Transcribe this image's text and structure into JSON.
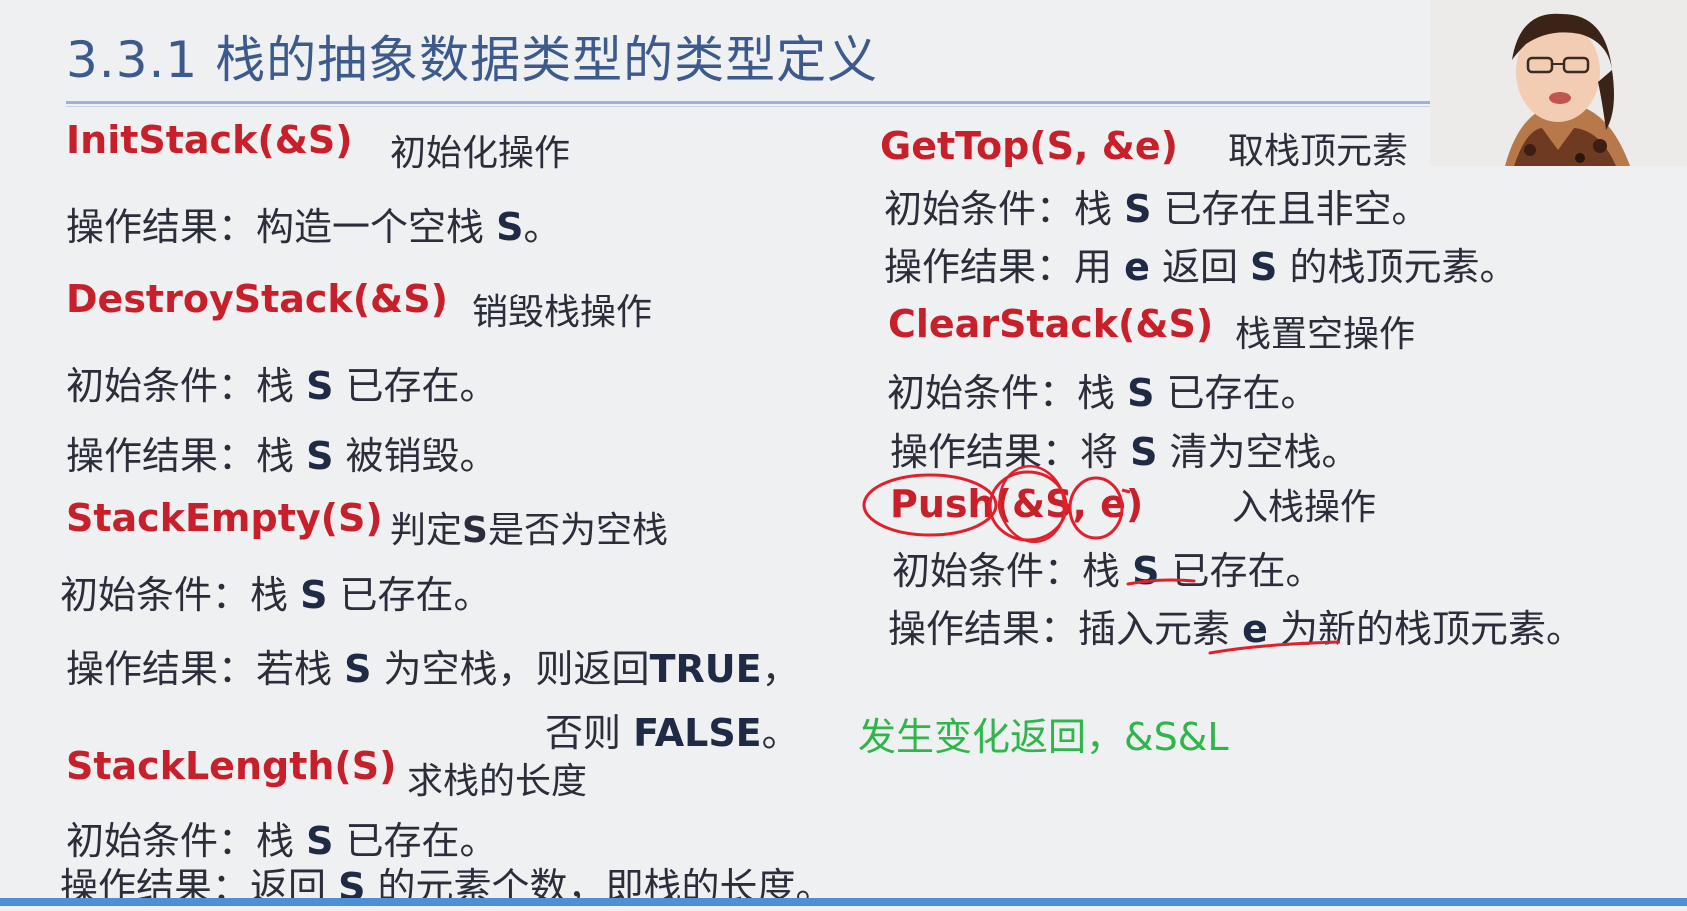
{
  "slide": {
    "title": "3.3.1 栈的抽象数据类型的类型定义"
  },
  "left": {
    "init": {
      "op": "InitStack(&S)",
      "desc": "初始化操作",
      "result_label": "操作结果：构造一个空栈 ",
      "result_s": "S",
      "result_end": "。"
    },
    "destroy": {
      "op": "DestroyStack(&S)",
      "desc": "销毁栈操作",
      "cond_label": "初始条件：栈 ",
      "cond_s": "S",
      "cond_end": " 已存在。",
      "result_label": "操作结果：栈 ",
      "result_s": "S",
      "result_end": " 被销毁。"
    },
    "empty": {
      "op": "StackEmpty(S)",
      "desc_pre": "判定",
      "desc_s": "S",
      "desc_post": "是否为空栈",
      "cond_label": "初始条件：栈 ",
      "cond_s": "S",
      "cond_end": " 已存在。",
      "result_label": "操作结果：若栈 ",
      "result_s": "S",
      "result_mid": " 为空栈，则返回",
      "result_true": "TRUE",
      "result_end": "，",
      "else_label": "否则 ",
      "else_false": "FALSE",
      "else_end": "。"
    },
    "length": {
      "op": "StackLength(S)",
      "desc": "求栈的长度",
      "cond_label": "初始条件：栈 ",
      "cond_s": "S",
      "cond_end": " 已存在。",
      "result_label": "操作结果：返回 ",
      "result_s": "S",
      "result_end": " 的元素个数，即栈的长度。"
    }
  },
  "right": {
    "gettop": {
      "op": "GetTop(S, &e)",
      "desc": "取栈顶元素",
      "cond_label": "初始条件：栈 ",
      "cond_s": "S",
      "cond_end": " 已存在且非空。",
      "result_label": "操作结果：用 ",
      "result_e": "e",
      "result_mid": " 返回 ",
      "result_s": "S",
      "result_end": " 的栈顶元素。"
    },
    "clear": {
      "op": "ClearStack(&S)",
      "desc": "栈置空操作",
      "cond_label": "初始条件：栈 ",
      "cond_s": "S",
      "cond_end": " 已存在。",
      "result_label": "操作结果：将 ",
      "result_s": "S",
      "result_end": " 清为空栈。"
    },
    "push": {
      "op": "Push(&S, e)",
      "desc": "入栈操作",
      "cond_label": "初始条件：栈 ",
      "cond_s": "S",
      "cond_end": " 已存在。",
      "result_label": "操作结果：插入元素 ",
      "result_e": "e",
      "result_end": " 为新的栈顶元素。"
    }
  },
  "annotation": {
    "text": "发生变化返回，&S&L",
    "color": "#2fb64a"
  },
  "colors": {
    "op_red": "#c8202a",
    "title_blue": "#3c5a8c",
    "annotation_ink": "#e0202a",
    "bottom_bar": "#4f8fd6"
  },
  "presenter": {
    "icon": "presenter-webcam-icon"
  }
}
